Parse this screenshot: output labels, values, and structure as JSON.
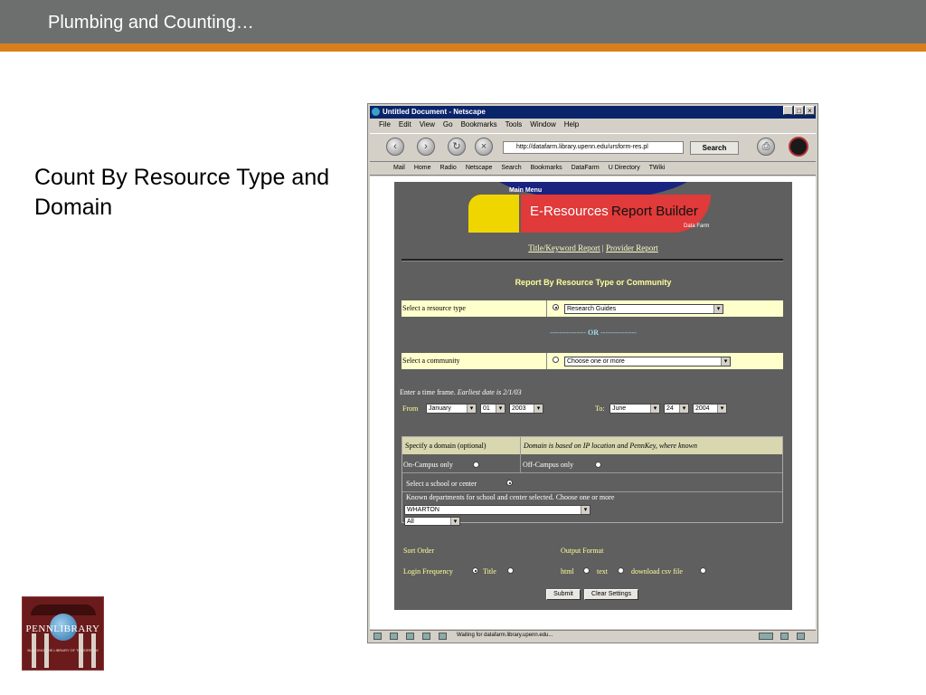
{
  "slide": {
    "title": "Plumbing and Counting…",
    "heading": "Count By Resource Type and Domain",
    "logo_text": "PENNLIBRARY",
    "logo_tagline": "BUILDING THE LIBRARY OF TOMORROW"
  },
  "browser": {
    "window_title": "Untitled Document - Netscape",
    "menu": [
      "File",
      "Edit",
      "View",
      "Go",
      "Bookmarks",
      "Tools",
      "Window",
      "Help"
    ],
    "url": "http://datafarm.library.upenn.edu/ursform-res.pl",
    "search_label": "Search",
    "bookmarks": [
      "Mail",
      "Home",
      "Radio",
      "Netscape",
      "Search",
      "Bookmarks",
      "DataFarm",
      "U Directory",
      "TWiki"
    ],
    "status": "Waiting for datafarm.library.upenn.edu..."
  },
  "page": {
    "main_menu": "Main Menu",
    "banner_e": "E-Resources",
    "banner_rb": "Report Builder",
    "banner_df": "Data Farm",
    "link_title": "Title/Keyword Report",
    "link_sep": "|",
    "link_provider": "Provider Report",
    "report_heading": "Report By Resource Type or Community",
    "resource_label": "Select a resource type",
    "resource_value": "Research Guides",
    "or_dashes_left": "---------------",
    "or_text": "OR",
    "or_dashes_right": "---------------",
    "community_label": "Select a community",
    "community_value": "Choose one or more",
    "timeframe_text": "Enter a time frame.",
    "timeframe_note": "Earliest date is 2/1/03",
    "from_label": "From",
    "from_month": "January",
    "from_day": "01",
    "from_year": "2003",
    "to_label": "To:",
    "to_month": "June",
    "to_day": "24",
    "to_year": "2004",
    "domain_header": "Specify a domain (optional)",
    "domain_note": "Domain is based on IP location and PennKey, where known",
    "on_campus": "On-Campus only",
    "off_campus": "Off-Campus only",
    "school_label": "Select a school or center",
    "departments_label": "Known departments for school and center selected. Choose one or more",
    "school_value": "WHARTON",
    "dept_value": "All",
    "sort_label": "Sort Order",
    "sort_login": "Login Frequency",
    "sort_title": "Title",
    "output_label": "Output Format",
    "out_html": "html",
    "out_text": "text",
    "out_csv": "download csv file",
    "submit": "Submit",
    "clear": "Clear Settings"
  },
  "colors": {
    "header_gray": "#6d6e6e",
    "stripe_orange": "#d97f1a",
    "panel_gray": "#5f5f5f"
  }
}
